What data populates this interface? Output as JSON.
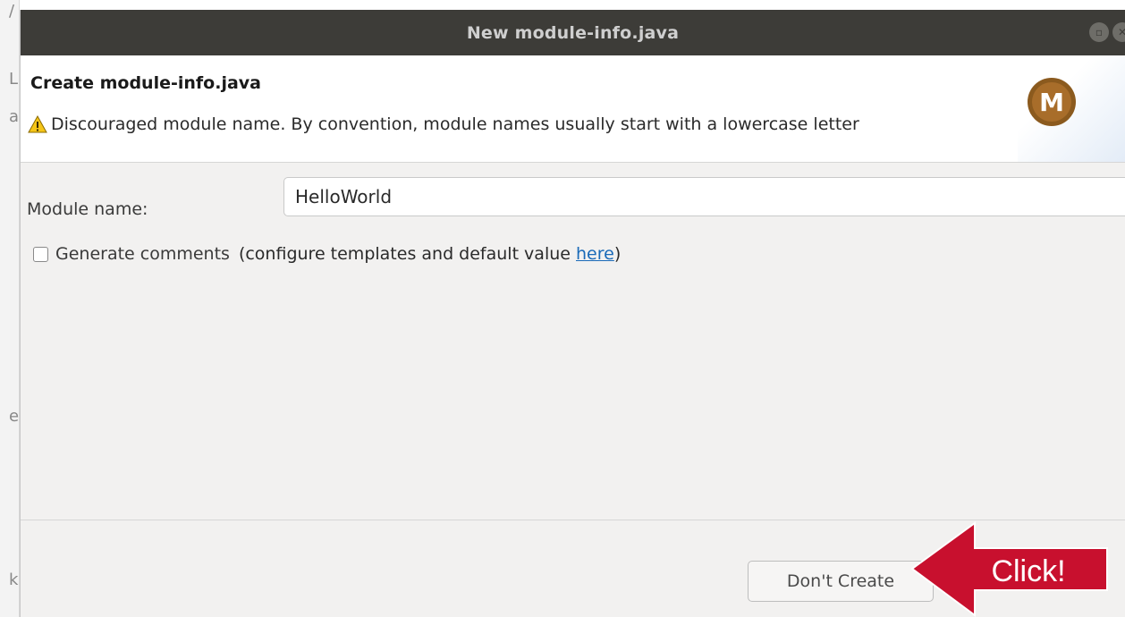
{
  "backdrop": {
    "glyphs": [
      "/",
      "L",
      "a",
      "e",
      "k"
    ]
  },
  "window": {
    "title": "New module-info.java",
    "controls": [
      "minimize-icon",
      "close-icon"
    ]
  },
  "header": {
    "title": "Create module-info.java",
    "message": "Discouraged module name. By convention, module names usually start with a lowercase letter",
    "logo_letter": "M",
    "colors": {
      "logo_brown": "#8b5a1e",
      "warning_yellow": "#f5c518"
    }
  },
  "form": {
    "module_name_label": "Module name:",
    "module_name_value": "HelloWorld",
    "generate_comments_label": "Generate comments",
    "generate_comments_checked": false,
    "configure_text_prefix": "(configure templates and default value ",
    "configure_link": "here",
    "configure_text_suffix": ")"
  },
  "buttons": {
    "dont_create": "Don't Create"
  },
  "annotation": {
    "label": "Click!",
    "color": "#c8102e"
  }
}
